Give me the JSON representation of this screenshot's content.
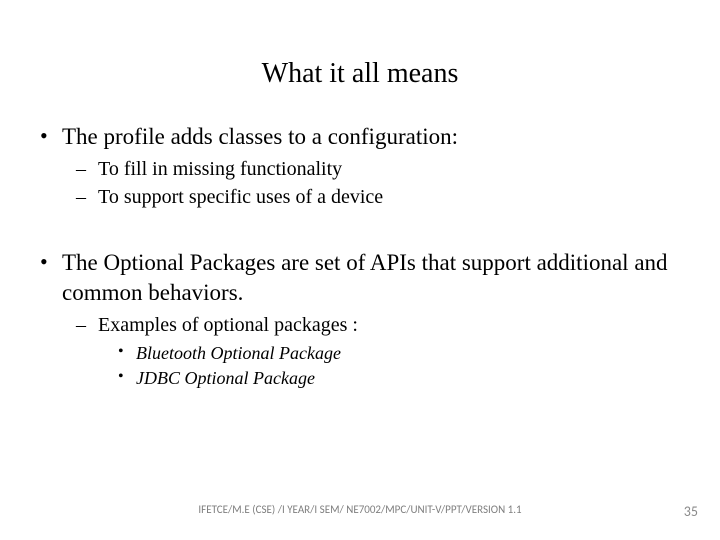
{
  "title": "What it all means",
  "bullets": {
    "b1": "The profile adds classes to a configuration:",
    "b1_1": "To fill in missing functionality",
    "b1_2": "To support specific uses of a device",
    "b2": "The Optional Packages are set of APIs that support additional and common behaviors.",
    "b2_1": "Examples of optional packages :",
    "b2_1_1": "Bluetooth Optional Package",
    "b2_1_2": "JDBC Optional Package"
  },
  "footer": "IFETCE/M.E (CSE) /I YEAR/I SEM/ NE7002/MPC/UNIT-V/PPT/VERSION 1.1",
  "page": "35"
}
